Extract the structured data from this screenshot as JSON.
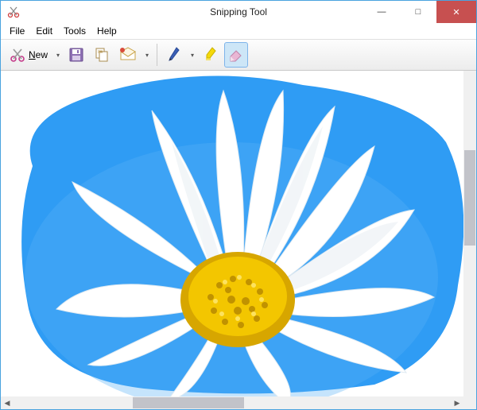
{
  "window": {
    "title": "Snipping Tool",
    "appicon": "scissors-icon"
  },
  "controls": {
    "minimize": "—",
    "maximize": "□",
    "close": "✕"
  },
  "menu": {
    "file": "File",
    "edit": "Edit",
    "tools": "Tools",
    "help": "Help"
  },
  "toolbar": {
    "new_label": "New",
    "save": "save-icon",
    "copy": "copy-icon",
    "send": "send-icon",
    "pen": "pen-icon",
    "highlighter": "highlighter-icon",
    "eraser": "eraser-icon"
  },
  "content": {
    "description": "free-form-snip-daisy-flower",
    "sky_color": "#2f9cf4",
    "petal_color": "#ffffff",
    "center_color": "#f3c600"
  }
}
